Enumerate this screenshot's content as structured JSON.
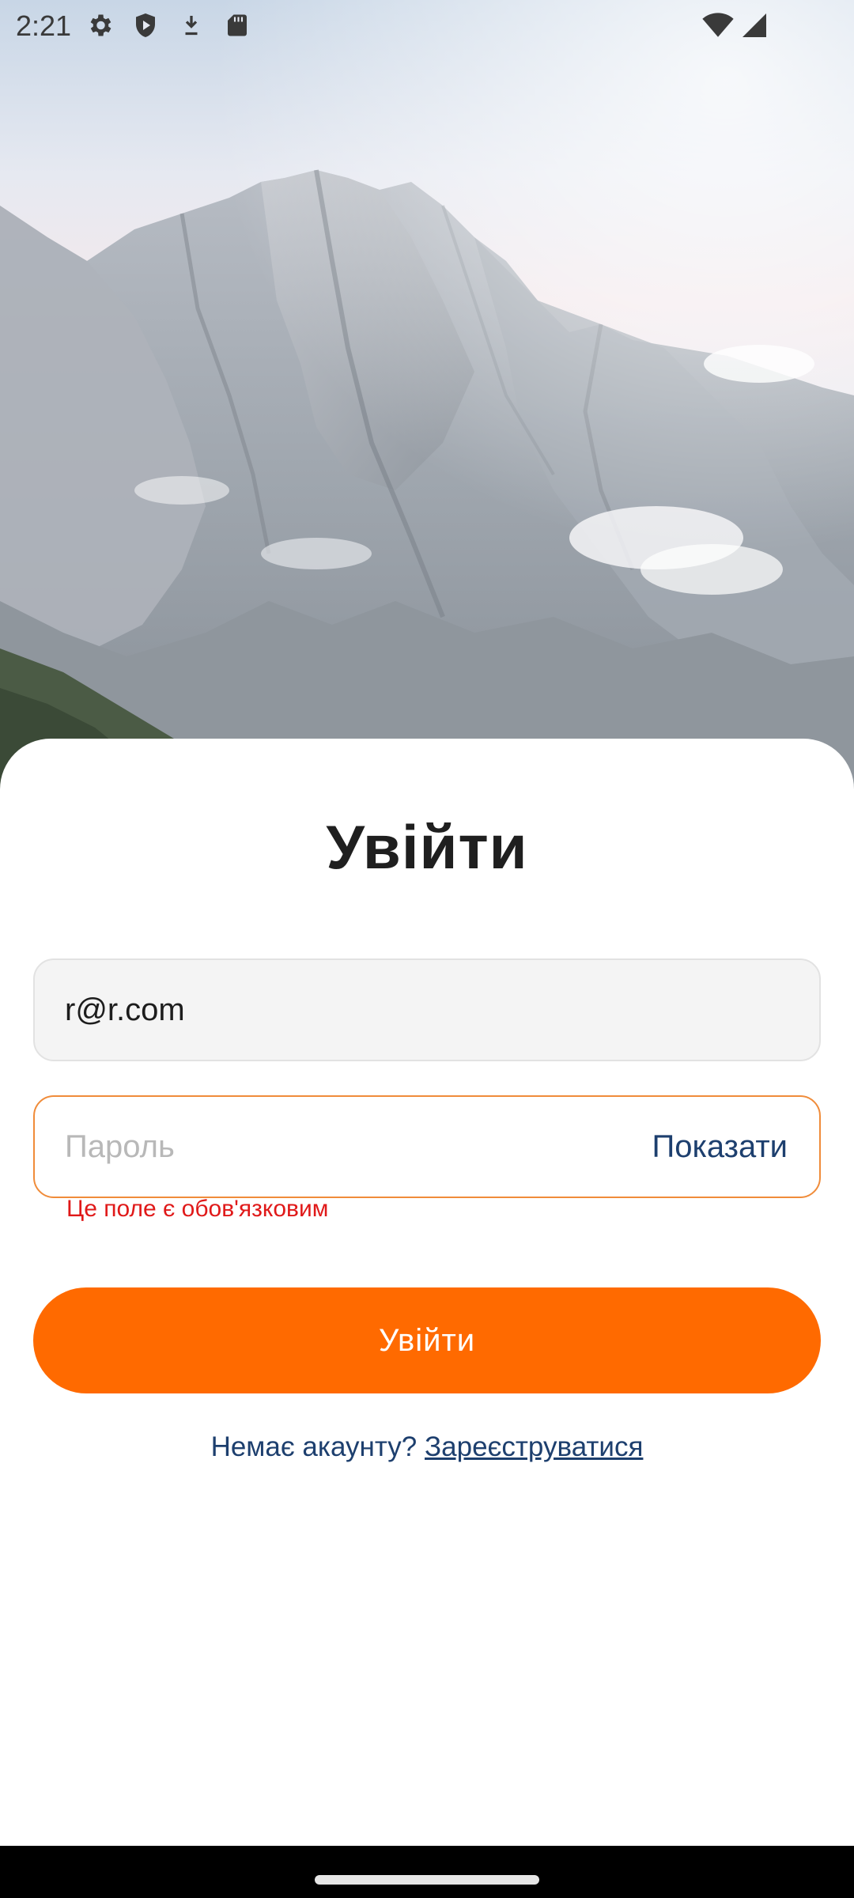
{
  "status_bar": {
    "time": "2:21",
    "icons": [
      "settings-gear-icon",
      "shield-play-icon",
      "download-icon",
      "sd-card-icon",
      "wifi-icon",
      "cell-signal-icon"
    ]
  },
  "login": {
    "title": "Увійти",
    "email_value": "r@r.com",
    "password_placeholder": "Пароль",
    "show_password_label": "Показати",
    "password_error": "Це поле є обов'язковим",
    "submit_label": "Увійти",
    "no_account_text": "Немає акаунту?",
    "register_link": "Зареєструватися"
  },
  "colors": {
    "accent": "#ff6a00",
    "link": "#1d3f6e",
    "error": "#e01919",
    "focus_border": "#f08c3a"
  }
}
